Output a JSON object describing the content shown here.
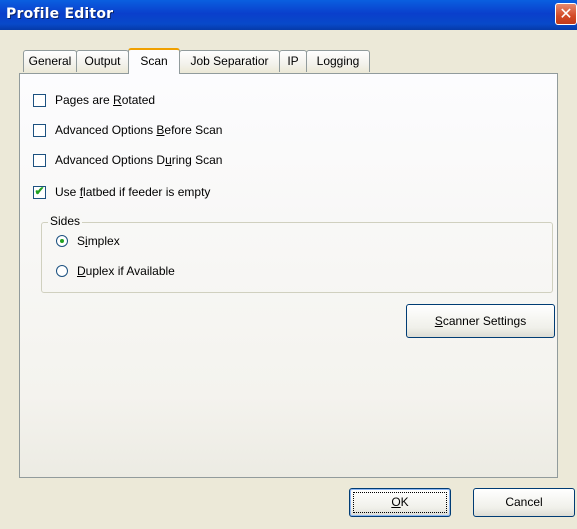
{
  "window": {
    "title": "Profile Editor",
    "close_glyph": "✕",
    "close_icon": "close-icon"
  },
  "tabs": [
    {
      "label": "General",
      "active": false
    },
    {
      "label": "Output",
      "active": false
    },
    {
      "label": "Scan",
      "active": true
    },
    {
      "label": "Job Separatior",
      "active": false
    },
    {
      "label": "IP",
      "active": false
    },
    {
      "label": "Logging",
      "active": false
    }
  ],
  "scan": {
    "options": [
      {
        "label_pre": "Pages are ",
        "hotkey": "R",
        "label_post": "otated",
        "checked": false
      },
      {
        "label_pre": "Advanced Options ",
        "hotkey": "B",
        "label_post": "efore Scan",
        "checked": false
      },
      {
        "label_pre": "Advanced Options D",
        "hotkey": "u",
        "label_post": "ring Scan",
        "checked": false
      },
      {
        "label_pre": "Use ",
        "hotkey": "f",
        "label_post": "latbed if feeder is empty",
        "checked": true
      }
    ],
    "check_glyph": "✔",
    "sides": {
      "title": "Sides",
      "options": [
        {
          "label_pre": "S",
          "hotkey": "i",
          "label_post": "mplex",
          "selected": true
        },
        {
          "label_pre": "",
          "hotkey": "D",
          "label_post": "uplex if Available",
          "selected": false
        }
      ]
    },
    "scanner_settings": {
      "label_pre": "",
      "hotkey": "S",
      "label_post": "canner Settings"
    }
  },
  "footer": {
    "ok": {
      "label_pre": "",
      "hotkey": "O",
      "label_post": "K"
    },
    "cancel": "Cancel"
  },
  "colors": {
    "title_bar": "#0a3fcc",
    "dialog_bg": "#ece9d8",
    "active_tab_accent": "#f0a000",
    "check_mark": "#21a121",
    "close_button": "#d34a26"
  }
}
